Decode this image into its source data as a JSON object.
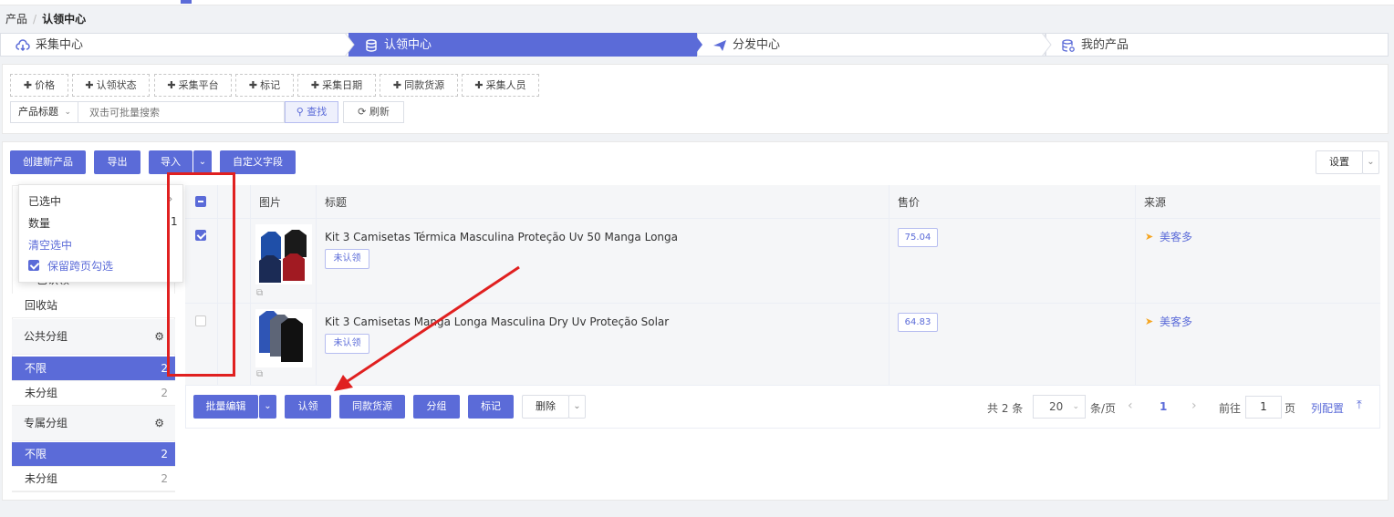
{
  "breadcrumb": {
    "root": "产品",
    "separator": "/",
    "current": "认领中心"
  },
  "steps": [
    {
      "label": "采集中心",
      "icon": "cloud-download-icon"
    },
    {
      "label": "认领中心",
      "icon": "database-icon"
    },
    {
      "label": "分发中心",
      "icon": "paper-plane-icon"
    },
    {
      "label": "我的产品",
      "icon": "database-settings-icon"
    }
  ],
  "filters": {
    "chips": [
      "价格",
      "认领状态",
      "采集平台",
      "标记",
      "采集日期",
      "同款货源",
      "采集人员"
    ],
    "field_select": "产品标题",
    "search_placeholder": "双击可批量搜索",
    "search_button": "查找",
    "refresh_button": "刷新"
  },
  "toolbar": {
    "create": "创建新产品",
    "export": "导出",
    "import": "导入",
    "custom_fields": "自定义字段",
    "settings": "设置"
  },
  "selection_popup": {
    "selected_label": "已选中",
    "count_label": "数量",
    "count_value": "1",
    "clear_label": "清空选中",
    "keep_label": "保留跨页勾选"
  },
  "sidebar": {
    "partial_item": "已认领",
    "recycle": "回收站",
    "groups": [
      {
        "title": "公共分组",
        "items": [
          {
            "label": "不限",
            "count": "2"
          },
          {
            "label": "未分组",
            "count": "2"
          }
        ]
      },
      {
        "title": "专属分组",
        "items": [
          {
            "label": "不限",
            "count": "2"
          },
          {
            "label": "未分组",
            "count": "2"
          }
        ]
      }
    ]
  },
  "table": {
    "columns": {
      "image": "图片",
      "title": "标题",
      "price": "售价",
      "source": "来源"
    },
    "rows": [
      {
        "title": "Kit 3 Camisetas Térmica Masculina Proteção Uv 50 Manga Longa",
        "status": "未认领",
        "price": "75.04",
        "source": "美客多",
        "checked": true
      },
      {
        "title": "Kit 3 Camisetas Manga Longa Masculina Dry Uv Proteção Solar",
        "status": "未认领",
        "price": "64.83",
        "source": "美客多",
        "checked": false
      }
    ]
  },
  "bulk": {
    "batch_edit": "批量编辑",
    "claim": "认领",
    "same_source": "同款货源",
    "group": "分组",
    "mark": "标记",
    "delete": "删除"
  },
  "pagination": {
    "total": "共 2 条",
    "page_size": "20",
    "per_page": "条/页",
    "current_page": "1",
    "goto_label": "前往",
    "goto_value": "1",
    "page_unit": "页",
    "columns_config": "列配置"
  },
  "colors": {
    "primary": "#5b6bd8",
    "annotation_red": "#e02020",
    "source_icon": "#f5a623"
  }
}
